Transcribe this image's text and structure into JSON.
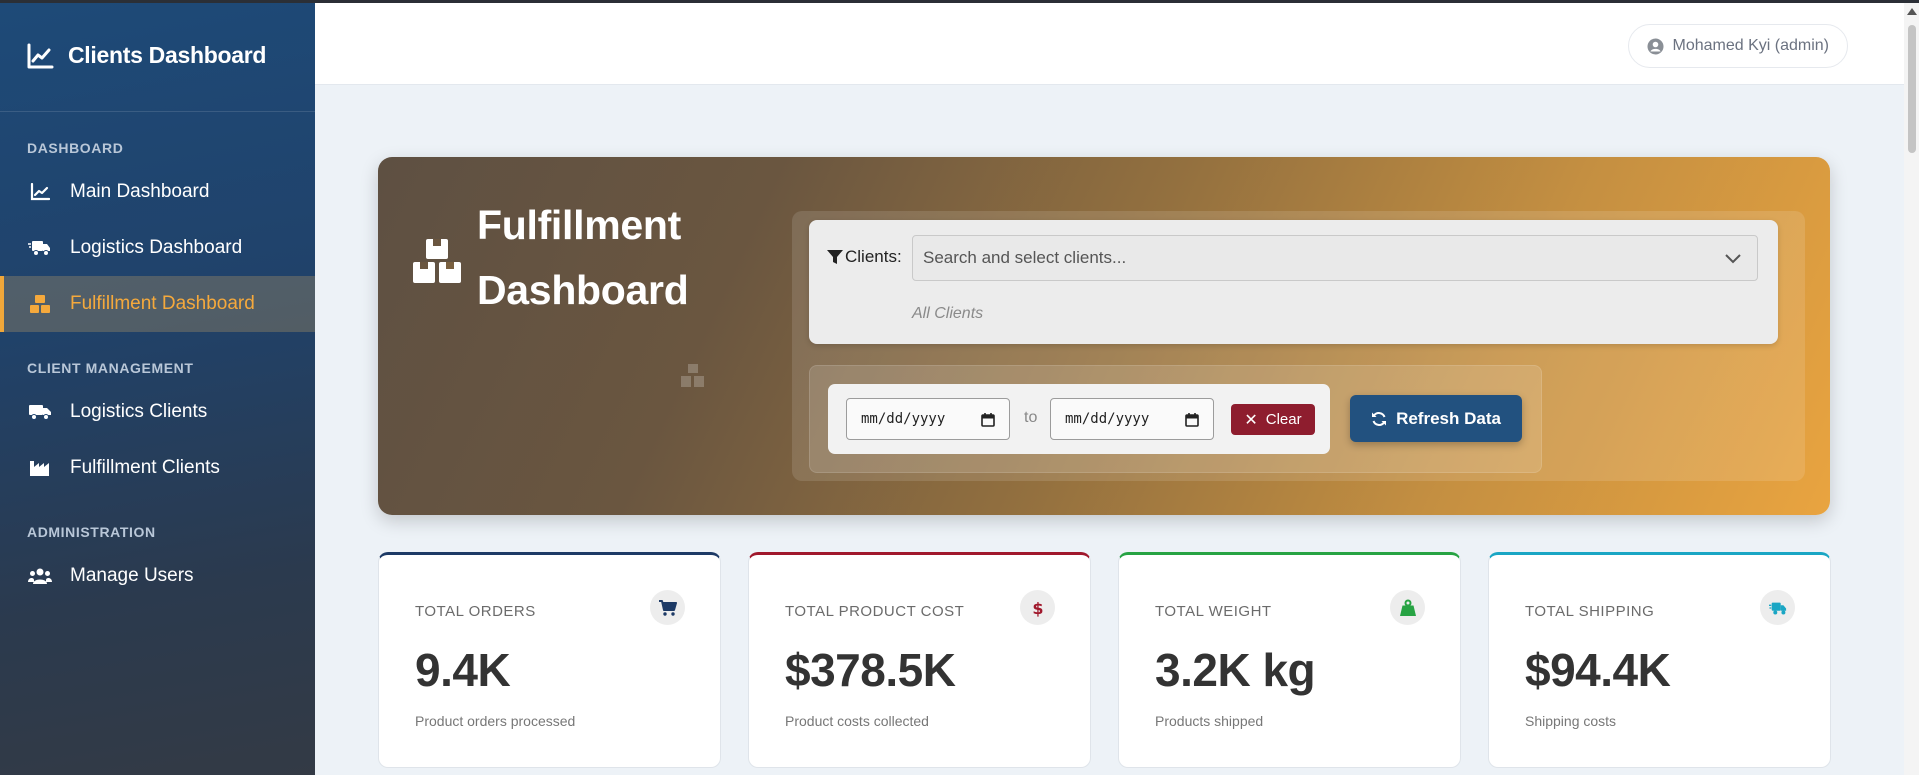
{
  "sidebar": {
    "brand": "Clients Dashboard",
    "sections": [
      {
        "label": "DASHBOARD"
      },
      {
        "label": "CLIENT MANAGEMENT"
      },
      {
        "label": "ADMINISTRATION"
      }
    ],
    "items": [
      {
        "label": "Main Dashboard",
        "icon": "chart-line-icon"
      },
      {
        "label": "Logistics Dashboard",
        "icon": "truck-fast-icon"
      },
      {
        "label": "Fulfillment Dashboard",
        "icon": "boxes-icon",
        "active": true
      },
      {
        "label": "Logistics Clients",
        "icon": "truck-icon"
      },
      {
        "label": "Fulfillment Clients",
        "icon": "industry-icon"
      },
      {
        "label": "Manage Users",
        "icon": "users-icon"
      }
    ]
  },
  "topbar": {
    "user": "Mohamed Kyi (admin)"
  },
  "hero": {
    "title_line1": "Fulfillment",
    "title_line2": "Dashboard",
    "clients_label": "Clients:",
    "clients_placeholder": "Search and select clients...",
    "clients_hint": "All Clients",
    "date_placeholder": "mm/dd/yyyy",
    "date_to": "to",
    "clear_label": "Clear",
    "refresh_label": "Refresh Data"
  },
  "cards": [
    {
      "label": "TOTAL ORDERS",
      "value": "9.4K",
      "sub": "Product orders processed",
      "accent": "#1d3a66",
      "icon": "cart-icon",
      "icon_color": "#1d3a66"
    },
    {
      "label": "TOTAL PRODUCT COST",
      "value": "$378.5K",
      "sub": "Product costs collected",
      "accent": "#a0182c",
      "icon": "dollar-icon",
      "icon_color": "#a0182c"
    },
    {
      "label": "TOTAL WEIGHT",
      "value": "3.2K kg",
      "sub": "Products shipped",
      "accent": "#27a343",
      "icon": "weight-icon",
      "icon_color": "#27a343"
    },
    {
      "label": "TOTAL SHIPPING",
      "value": "$94.4K",
      "sub": "Shipping costs",
      "accent": "#1aa6c4",
      "icon": "shipping-truck-icon",
      "icon_color": "#1aa6c4"
    }
  ]
}
